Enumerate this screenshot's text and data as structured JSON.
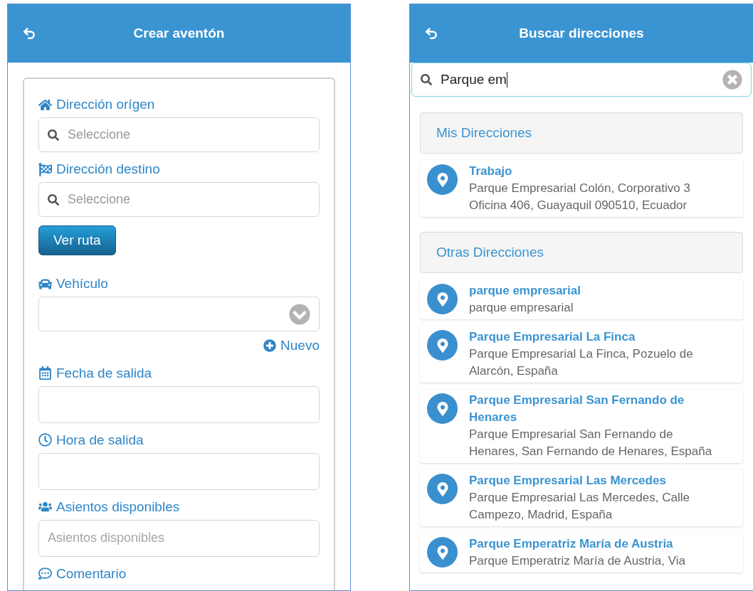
{
  "left_screen": {
    "title": "Crear aventón",
    "form_fields": [
      {
        "kind": "search",
        "label": "Dirección orígen",
        "placeholder": "Seleccione"
      },
      {
        "kind": "search",
        "label": "Dirección destino",
        "placeholder": "Seleccione"
      },
      {
        "kind": "button",
        "label": "Ver ruta"
      },
      {
        "kind": "select",
        "label": "Vehículo",
        "link": "Nuevo"
      },
      {
        "kind": "text",
        "label": "Fecha de salida"
      },
      {
        "kind": "text",
        "label": "Hora de salida"
      },
      {
        "kind": "text",
        "label": "Asientos disponibles",
        "placeholder": "Asientos disponibles"
      },
      {
        "kind": "label",
        "label": "Comentario"
      }
    ]
  },
  "right_screen": {
    "title": "Buscar direcciones",
    "search": {
      "value": "Parque em"
    },
    "sections": [
      {
        "heading": "Mis Direcciones",
        "results": [
          {
            "name": "Trabajo",
            "address": "Parque Empresarial Colón, Corporativo 3 Oficina 406, Guayaquil 090510, Ecuador"
          }
        ]
      },
      {
        "heading": "Otras Direcciones",
        "results": [
          {
            "name": "parque empresarial",
            "address": "parque empresarial"
          },
          {
            "name": "Parque Empresarial La Finca",
            "address": "Parque Empresarial La Finca, Pozuelo de Alarcón, España"
          },
          {
            "name": "Parque Empresarial San Fernando de Henares",
            "address": "Parque Empresarial San Fernando de Henares, San Fernando de Henares, España"
          },
          {
            "name": "Parque Empresarial Las Mercedes",
            "address": "Parque Empresarial Las Mercedes, Calle Campezo, Madrid, España"
          },
          {
            "name": "Parque Emperatriz María de Austria",
            "address": "Parque Emperatriz María de Austria, Via"
          }
        ]
      }
    ]
  }
}
